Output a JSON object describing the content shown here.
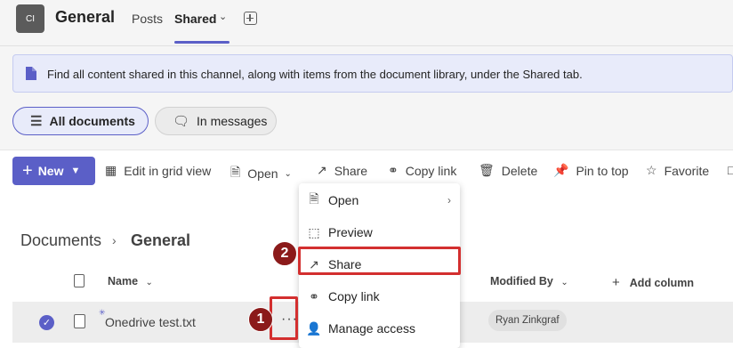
{
  "header": {
    "avatar_initials": "CI",
    "channel_name": "General",
    "tabs": [
      {
        "label": "Posts"
      },
      {
        "label": "Shared"
      }
    ],
    "accent_color": "#5b5fc7"
  },
  "banner": {
    "text": "Find all content shared in this channel, along with items from the document library, under the Shared tab."
  },
  "filters": {
    "all_documents": "All documents",
    "in_messages": "In messages"
  },
  "commandbar": {
    "new": "New",
    "edit_grid": "Edit in grid view",
    "open": "Open",
    "share": "Share",
    "copy_link": "Copy link",
    "delete": "Delete",
    "pin_to_top": "Pin to top",
    "favorite": "Favorite"
  },
  "breadcrumb": {
    "root": "Documents",
    "current": "General"
  },
  "columns": {
    "name": "Name",
    "modified_by": "Modified By",
    "add_column": "Add column"
  },
  "files": [
    {
      "name": "Onedrive test.txt",
      "modified_by": "Ryan Zinkgraf"
    }
  ],
  "context_menu": {
    "items": [
      {
        "label": "Open",
        "icon": "open-icon"
      },
      {
        "label": "Preview",
        "icon": "preview-icon"
      },
      {
        "label": "Share",
        "icon": "share-icon"
      },
      {
        "label": "Copy link",
        "icon": "link-icon"
      },
      {
        "label": "Manage access",
        "icon": "person-icon"
      }
    ]
  },
  "callouts": {
    "one": "1",
    "two": "2",
    "color": "#d32f2f"
  }
}
